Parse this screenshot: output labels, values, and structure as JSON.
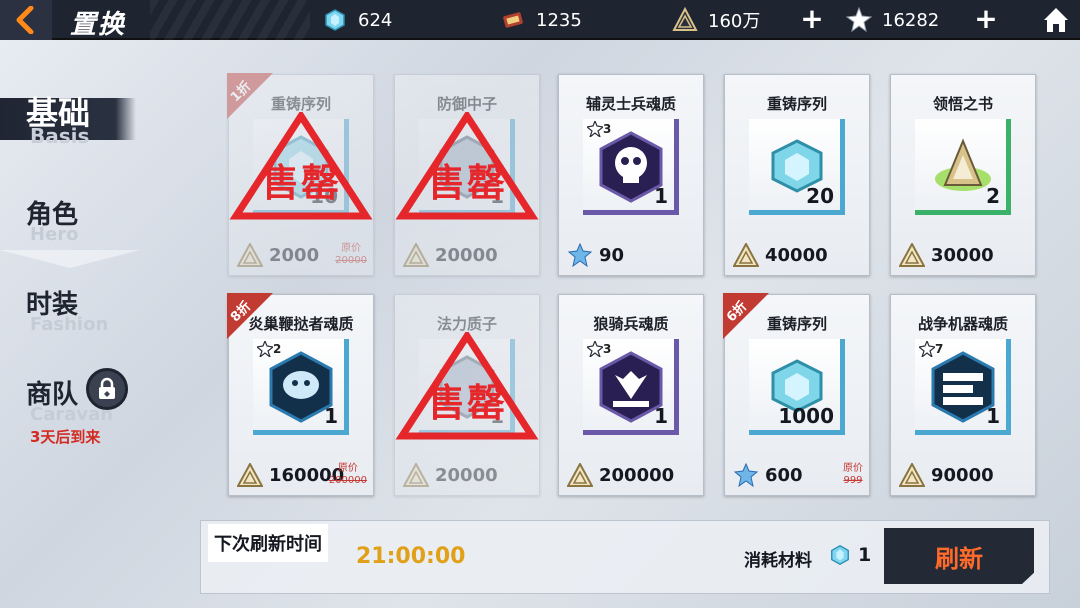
{
  "header": {
    "title": "置换",
    "resources": [
      {
        "name": "crystal",
        "value": "624",
        "color": "#7fd6f0"
      },
      {
        "name": "ticket",
        "value": "1235",
        "color": "#b04030"
      },
      {
        "name": "gold",
        "value": "160万",
        "color": "#d8c28a"
      },
      {
        "name": "star-crystal",
        "value": "16282",
        "color": "#ffffff"
      }
    ]
  },
  "nav": {
    "items": [
      {
        "cn": "基础",
        "en": "Basis"
      },
      {
        "cn": "角色",
        "en": "Hero"
      },
      {
        "cn": "时装",
        "en": "Fashion"
      },
      {
        "cn": "商队",
        "en": "Caravan"
      }
    ],
    "caravan_sub": "3天后到来"
  },
  "cards": [
    {
      "name": "重铸序列",
      "qty": "10",
      "price": "2000",
      "orig_label": "原价",
      "orig_price": "20000",
      "discount": "1折",
      "soldout": true
    },
    {
      "name": "防御中子",
      "qty": "1",
      "price": "20000",
      "soldout": true
    },
    {
      "name": "辅灵士兵魂质",
      "qty": "1",
      "stars": "3",
      "price": "90",
      "currency": "star"
    },
    {
      "name": "重铸序列",
      "qty": "20",
      "price": "40000"
    },
    {
      "name": "领悟之书",
      "qty": "2",
      "price": "30000"
    },
    {
      "name": "炎巢鞭挞者魂质",
      "qty": "1",
      "stars": "2",
      "price": "160000",
      "orig_label": "原价",
      "orig_price": "200000",
      "discount": "8折"
    },
    {
      "name": "法力质子",
      "qty": "1",
      "price": "20000",
      "soldout": true
    },
    {
      "name": "狼骑兵魂质",
      "qty": "1",
      "stars": "3",
      "price": "200000"
    },
    {
      "name": "重铸序列",
      "qty": "1000",
      "price": "600",
      "orig_label": "原价",
      "orig_price": "999",
      "discount": "6折",
      "currency": "star"
    },
    {
      "name": "战争机器魂质",
      "qty": "1",
      "stars": "7",
      "price": "90000"
    }
  ],
  "soldout_stamp": "售罄",
  "footer": {
    "refresh_label": "下次刷新时间",
    "refresh_time": "21:00:00",
    "cost_label": "消耗材料",
    "cost_qty": "1",
    "refresh_button": "刷新"
  }
}
